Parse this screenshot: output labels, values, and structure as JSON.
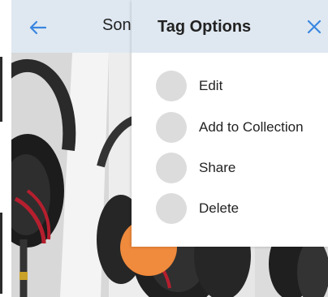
{
  "header": {
    "title": "Son"
  },
  "panel": {
    "title": "Tag Options",
    "options": [
      {
        "label": "Edit"
      },
      {
        "label": "Add to Collection"
      },
      {
        "label": "Share"
      },
      {
        "label": "Delete"
      }
    ]
  },
  "colors": {
    "accent": "#3a86e0",
    "header_bg": "#dfe8f1",
    "fab": "#f08a3c",
    "option_circle": "#dcdcdc"
  },
  "icons": {
    "back": "arrow-left-icon",
    "close": "close-icon",
    "fab": "chevron-down-icon"
  }
}
